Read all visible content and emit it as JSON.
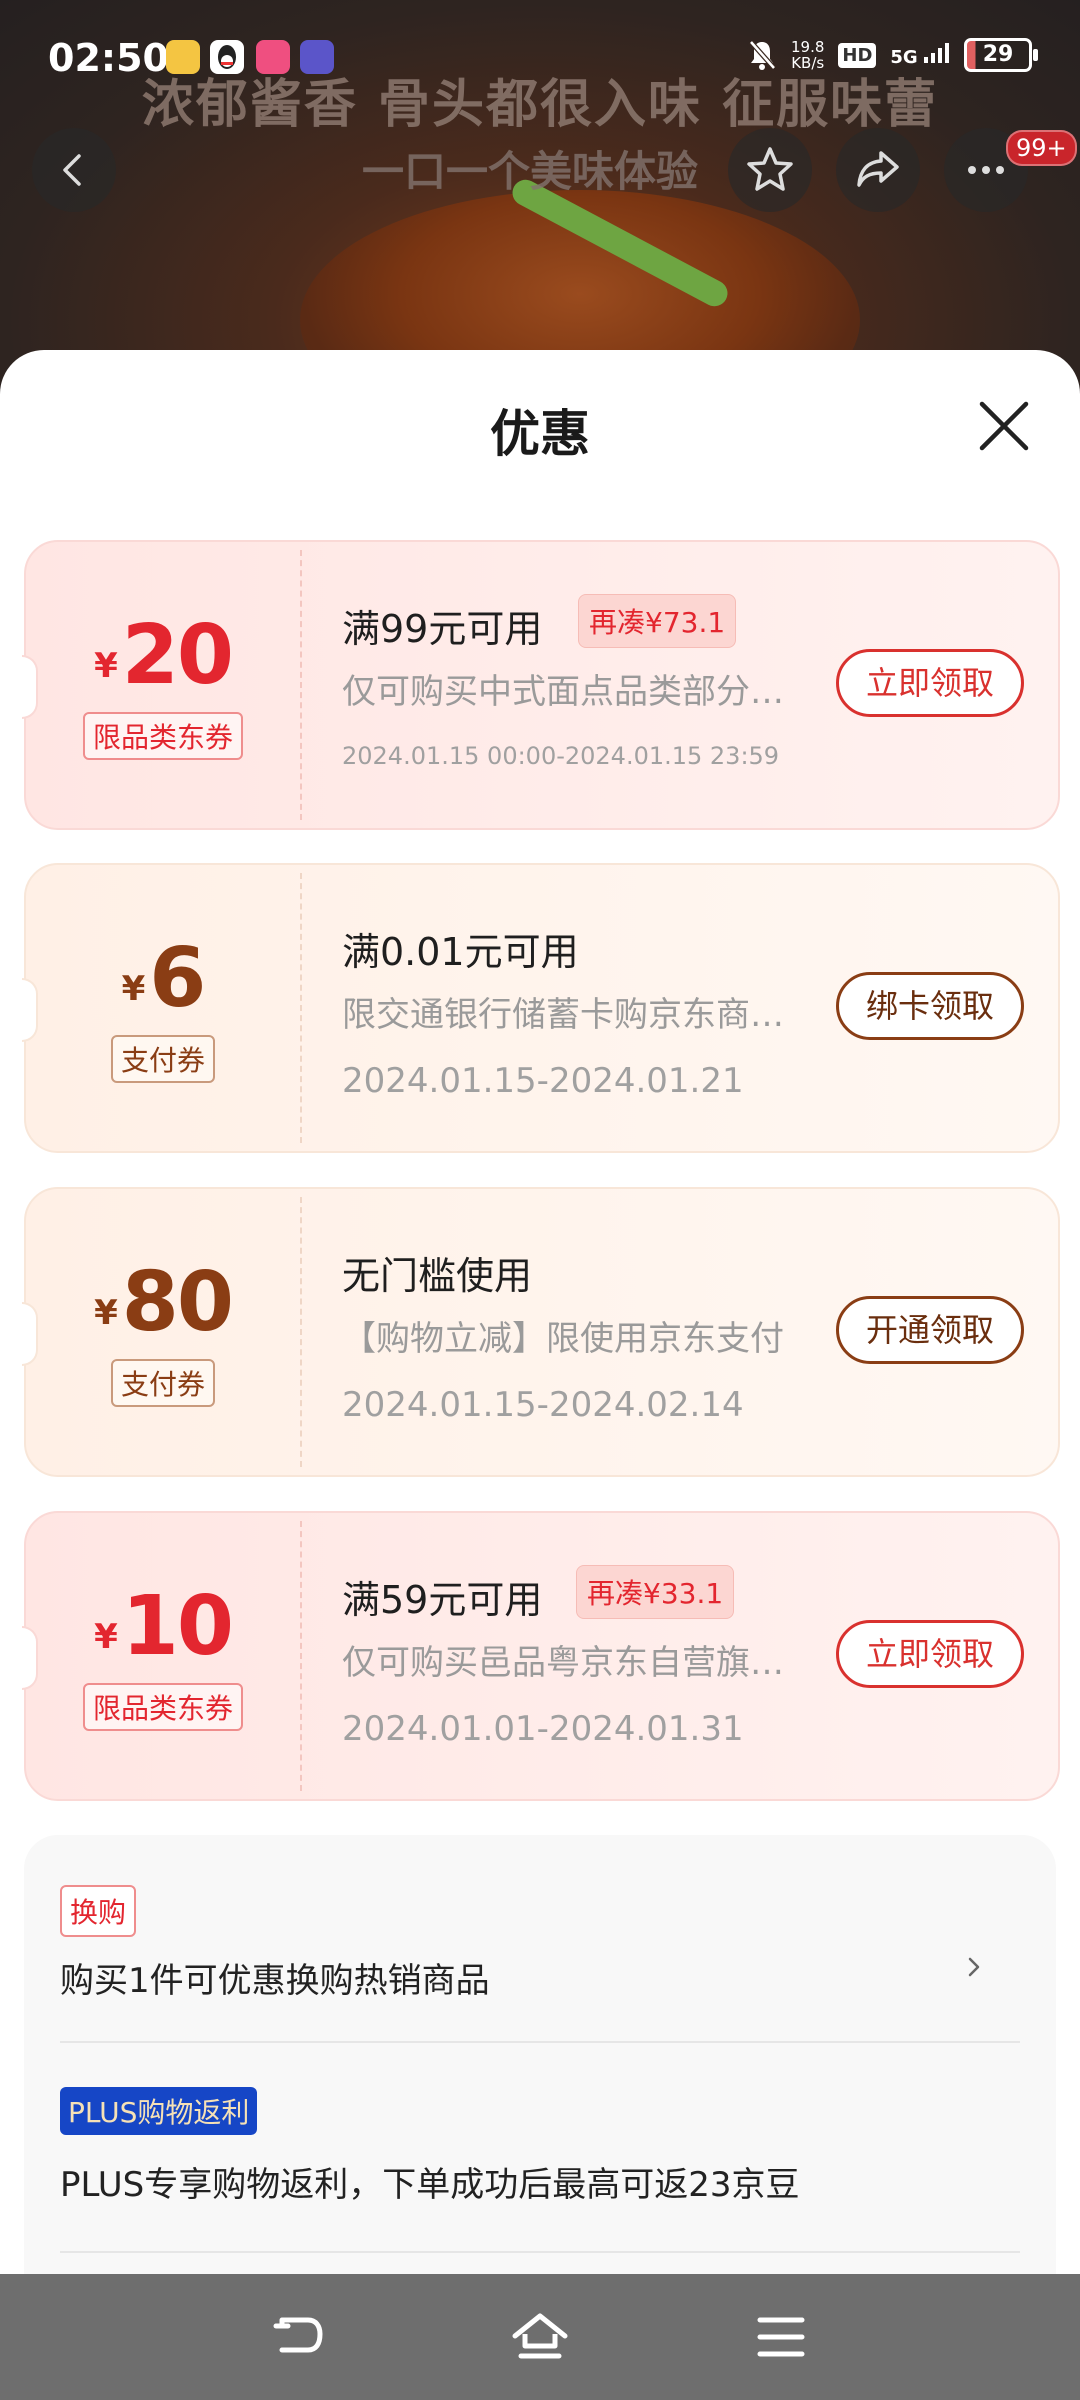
{
  "status_bar": {
    "time": "02:50",
    "net_speed_value": "19.8",
    "net_speed_unit": "KB/s",
    "hd": "HD",
    "signal": "5G",
    "battery": "29"
  },
  "hero": {
    "headline": "浓郁酱香 骨头都很入味 征服味蕾",
    "subline": "一口一个美味体验",
    "badge": "99+"
  },
  "sheet": {
    "title": "优惠"
  },
  "coupons": [
    {
      "yen": "¥",
      "amount": "20",
      "tag": "限品类东券",
      "condition": "满99元可用",
      "extra": "再凑¥73.1",
      "description": "仅可购买中式面点品类部分商品",
      "date": "2024.01.15 00:00-2024.01.15 23:59",
      "button": "立即领取"
    },
    {
      "yen": "¥",
      "amount": "6",
      "tag": "支付券",
      "condition": "满0.01元可用",
      "description": "限交通银行储蓄卡购京东商品使用",
      "date": "2024.01.15-2024.01.21",
      "button": "绑卡领取"
    },
    {
      "yen": "¥",
      "amount": "80",
      "tag": "支付券",
      "condition": "无门槛使用",
      "description": "【购物立减】限使用京东支付",
      "date": "2024.01.15-2024.02.14",
      "button": "开通领取"
    },
    {
      "yen": "¥",
      "amount": "10",
      "tag": "限品类东券",
      "condition": "满59元可用",
      "extra": "再凑¥33.1",
      "description": "仅可购买邑品粤京东自营旗舰店部分商品",
      "date": "2024.01.01-2024.01.31",
      "button": "立即领取"
    }
  ],
  "promos": {
    "swap_tag": "换购",
    "swap_text": "购买1件可优惠换购热销商品",
    "plus_tag": "PLUS购物返利",
    "plus_text": "PLUS专享购物返利，下单成功后最高可返23京豆"
  },
  "colors": {
    "accent_red": "#e3262f",
    "pay_brown": "#8a3d14",
    "plus_blue": "#1646c6"
  },
  "icons": {
    "back": "chevron-left-icon",
    "favorite": "star-icon",
    "share": "share-icon",
    "more": "more-dots-icon",
    "close": "close-icon",
    "nav_back": "nav-back-icon",
    "nav_home": "nav-home-icon",
    "nav_menu": "nav-menu-icon"
  }
}
